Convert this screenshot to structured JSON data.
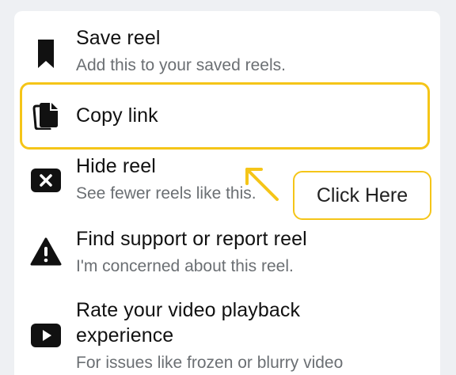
{
  "menu": {
    "items": [
      {
        "title": "Save reel",
        "subtitle": "Add this to your saved reels.",
        "icon": "bookmark-icon"
      },
      {
        "title": "Copy link",
        "icon": "copy-icon"
      },
      {
        "title": "Hide reel",
        "subtitle": "See fewer reels like this.",
        "icon": "close-box-icon"
      },
      {
        "title": "Find support or report reel",
        "subtitle": "I'm concerned about this reel.",
        "icon": "warning-icon"
      },
      {
        "title_line1": "Rate your video playback",
        "title_line2": "experience",
        "subtitle": "For issues like frozen or blurry video",
        "icon": "play-icon"
      }
    ]
  },
  "annotation": {
    "callout_text": "Click Here",
    "highlight_color": "#f5c518"
  }
}
